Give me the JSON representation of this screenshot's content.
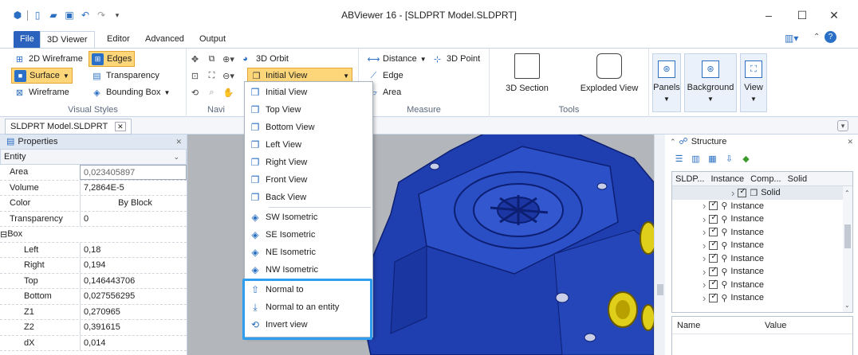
{
  "window": {
    "title": "ABViewer 16 - [SLDPRT Model.SLDPRT]",
    "minimize": "–",
    "maximize": "☐",
    "close": "✕"
  },
  "tabs": [
    "File",
    "3D Viewer",
    "Editor",
    "Advanced",
    "Output"
  ],
  "ribbon": {
    "visual_styles": {
      "label": "Visual Styles",
      "wireframe2d": "2D Wireframe",
      "edges": "Edges",
      "surface": "Surface",
      "transparency": "Transparency",
      "wireframe": "Wireframe",
      "bounding_box": "Bounding Box"
    },
    "navigation": {
      "label": "Navi",
      "orbit": "3D Orbit",
      "view_select": "Initial View"
    },
    "measure": {
      "label": "Measure",
      "distance": "Distance",
      "point3d": "3D Point",
      "edge": "Edge",
      "area": "Area"
    },
    "tools": {
      "label": "Tools",
      "section": "3D Section",
      "exploded": "Exploded View"
    },
    "panels": "Panels",
    "background": "Background",
    "view": "View"
  },
  "doc_tab": "SLDPRT Model.SLDPRT",
  "properties": {
    "title": "Properties",
    "entity": "Entity",
    "rows": [
      {
        "k": "Area",
        "v": "0,023405897"
      },
      {
        "k": "Volume",
        "v": "7,2864E-5"
      },
      {
        "k": "Color",
        "v": "By Block"
      },
      {
        "k": "Transparency",
        "v": "0"
      },
      {
        "k": "Box",
        "v": ""
      },
      {
        "k": "Left",
        "v": "0,18"
      },
      {
        "k": "Right",
        "v": "0,194"
      },
      {
        "k": "Top",
        "v": "0,146443706"
      },
      {
        "k": "Bottom",
        "v": "0,027556295"
      },
      {
        "k": "Z1",
        "v": "0,270965"
      },
      {
        "k": "Z2",
        "v": "0,391615"
      },
      {
        "k": "dX",
        "v": "0,014"
      }
    ]
  },
  "view_menu": {
    "items": [
      "Initial View",
      "Top View",
      "Bottom View",
      "Left View",
      "Right View",
      "Front View",
      "Back View",
      "SW Isometric",
      "SE Isometric",
      "NE Isometric",
      "NW Isometric",
      "Normal to",
      "Normal to an entity",
      "Invert view"
    ]
  },
  "structure": {
    "title": "Structure",
    "columns": [
      "SLDP...",
      "Instance",
      "Comp...",
      "Solid"
    ],
    "solid_label": "Solid",
    "instance_label": "Instance",
    "prop_headers": [
      "Name",
      "Value"
    ]
  }
}
